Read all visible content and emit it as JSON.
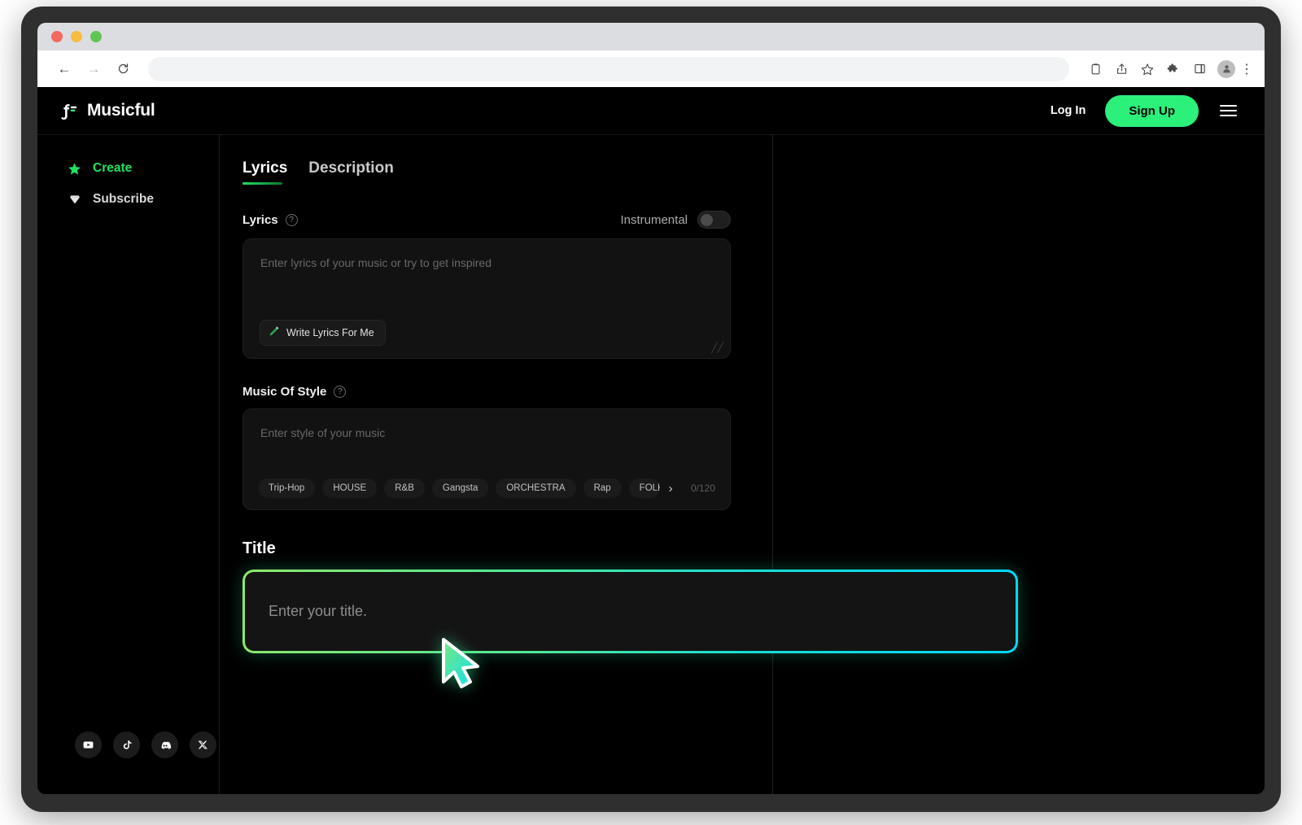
{
  "browser": {
    "url_value": "",
    "url_placeholder": "",
    "nav": {
      "back": "←",
      "forward": "→",
      "reload": "↻"
    },
    "toolbar_icons": [
      "clipboard-icon",
      "share-icon",
      "bookmark-star-icon",
      "extensions-puzzle-icon",
      "side-panel-icon",
      "profile-avatar-icon",
      "browser-menu-icon"
    ],
    "menu_glyph": "⋮"
  },
  "header": {
    "brand": "Musicful",
    "login_label": "Log In",
    "signup_label": "Sign Up",
    "accent_green": "#2bf07a"
  },
  "sidebar": {
    "items": [
      {
        "label": "Create",
        "icon": "star-icon",
        "active": true
      },
      {
        "label": "Subscribe",
        "icon": "gem-icon",
        "active": false
      }
    ],
    "socials": [
      "youtube-icon",
      "tiktok-icon",
      "discord-icon",
      "x-twitter-icon"
    ]
  },
  "editor": {
    "tabs": [
      {
        "label": "Lyrics",
        "active": true
      },
      {
        "label": "Description",
        "active": false
      }
    ],
    "lyrics": {
      "label": "Lyrics",
      "help_glyph": "?",
      "instrumental_label": "Instrumental",
      "instrumental_on": false,
      "placeholder": "Enter lyrics of your music or try to get inspired",
      "value": "",
      "write_button_label": "Write Lyrics For Me",
      "write_button_icon": "pencil-icon",
      "resize_glyph": "╱╱"
    },
    "style": {
      "label": "Music Of Style",
      "help_glyph": "?",
      "placeholder": "Enter style of your music",
      "value": "",
      "chips": [
        "Trip-Hop",
        "HOUSE",
        "R&B",
        "Gangsta",
        "ORCHESTRA",
        "Rap",
        "FOLK"
      ],
      "next_glyph": "›",
      "counter": "0/120"
    },
    "title": {
      "heading": "Title",
      "placeholder": "Enter your title.",
      "value": "",
      "focus_gradient_start": "#8ce86a",
      "focus_gradient_end": "#00d8ff"
    }
  },
  "cursor": {
    "name": "mouse-pointer",
    "gradient_start": "#7ae87f",
    "gradient_end": "#18e2ea"
  }
}
